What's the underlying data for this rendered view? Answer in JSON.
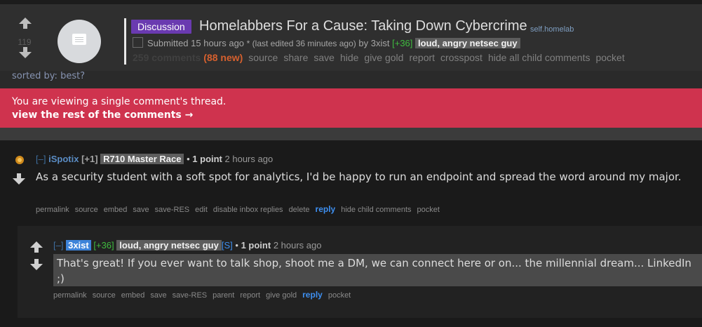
{
  "post": {
    "score": "119",
    "flair": "Discussion",
    "title": "Homelabbers For a Cause: Taking Down Cybercrime",
    "domain": "self.homelab",
    "submitted": "Submitted 15 hours ago",
    "edited": "* (last edited 36 minutes ago)",
    "by": "by",
    "author": "3xist",
    "karma": "[+36]",
    "user_flair": "loud, angry netsec guy",
    "comments": "259 comments",
    "new_comments": "(88 new)",
    "actions": [
      "source",
      "share",
      "save",
      "hide",
      "give gold",
      "report",
      "crosspost",
      "hide all child comments",
      "pocket"
    ]
  },
  "sorted_by": "sorted by: best?",
  "banner": {
    "line1": "You are viewing a single comment's thread.",
    "line2": "view the rest of the comments →"
  },
  "comment1": {
    "collapse": "[–]",
    "author": "iSpotix",
    "karma": "[+1]",
    "flair": "R710 Master Race",
    "bullet": "•",
    "points": "1 point",
    "time": "2 hours ago",
    "body": "As a security student with a soft spot for analytics, I'd be happy to run an endpoint and spread the word around my major.",
    "actions": [
      "permalink",
      "source",
      "embed",
      "save",
      "save-RES",
      "edit",
      "disable inbox replies",
      "delete"
    ],
    "reply": "reply",
    "actions2": [
      "hide child comments",
      "pocket"
    ]
  },
  "comment2": {
    "collapse": "[–]",
    "author": "3xist",
    "karma": "[+36]",
    "flair": "loud, angry netsec guy",
    "mod": "[S]",
    "bullet": "•",
    "points": "1 point",
    "time": "2 hours ago",
    "body": "That's great! If you ever want to talk shop, shoot me a DM, we can connect here or on... the millennial dream... LinkedIn ;)",
    "actions": [
      "permalink",
      "source",
      "embed",
      "save",
      "save-RES",
      "parent",
      "report",
      "give gold"
    ],
    "reply": "reply",
    "actions2": [
      "pocket"
    ]
  }
}
